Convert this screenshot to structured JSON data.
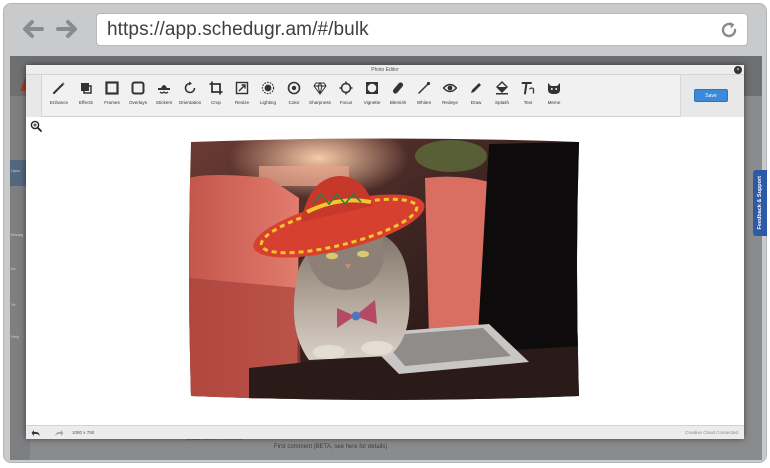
{
  "browser": {
    "url": "https://app.schedugr.am/#/bulk"
  },
  "app": {
    "sidebar_labels": [
      "Upco",
      "Manag",
      "Ac",
      "Ye",
      "Help"
    ],
    "footer_comment": "First comment (BETA, see here for details)",
    "footer_small": "Upload location in Comment"
  },
  "feedback": {
    "label": "Feedback & Support"
  },
  "editor": {
    "title": "Photo Editor",
    "close_glyph": "×",
    "save_label": "Save",
    "image_size": "1080 x 750",
    "cloud_status": "Creative Cloud Connected",
    "tools": [
      {
        "label": "Enhance",
        "icon": "magic-wand-icon"
      },
      {
        "label": "Effects",
        "icon": "effects-icon"
      },
      {
        "label": "Frames",
        "icon": "frames-icon"
      },
      {
        "label": "Overlays",
        "icon": "overlays-icon"
      },
      {
        "label": "Stickers",
        "icon": "stickers-icon"
      },
      {
        "label": "Orientation",
        "icon": "orientation-icon"
      },
      {
        "label": "Crop",
        "icon": "crop-icon"
      },
      {
        "label": "Resize",
        "icon": "resize-icon"
      },
      {
        "label": "Lighting",
        "icon": "lighting-icon"
      },
      {
        "label": "Color",
        "icon": "color-icon"
      },
      {
        "label": "Sharpness",
        "icon": "sharpness-icon"
      },
      {
        "label": "Focus",
        "icon": "focus-icon"
      },
      {
        "label": "Vignette",
        "icon": "vignette-icon"
      },
      {
        "label": "Blemish",
        "icon": "blemish-icon"
      },
      {
        "label": "Whiten",
        "icon": "whiten-icon"
      },
      {
        "label": "Redeye",
        "icon": "redeye-icon"
      },
      {
        "label": "Draw",
        "icon": "draw-icon"
      },
      {
        "label": "Splash",
        "icon": "splash-icon"
      },
      {
        "label": "Text",
        "icon": "text-icon"
      },
      {
        "label": "Meme",
        "icon": "meme-icon"
      }
    ]
  },
  "colors": {
    "accent": "#3b8ad9",
    "feedback": "#2d5aa6"
  }
}
